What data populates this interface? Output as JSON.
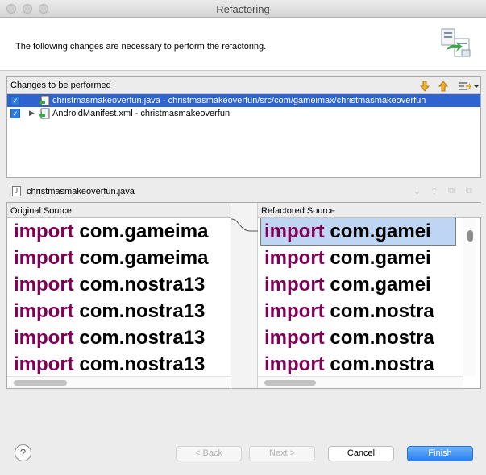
{
  "window": {
    "title": "Refactoring"
  },
  "banner": {
    "message": "The following changes are necessary to perform the refactoring."
  },
  "changes": {
    "header": "Changes to be performed",
    "items": [
      {
        "label": "christmasmakeoverfun.java - christmasmakeoverfun/src/com/gameimax/christmasmakeoverfun",
        "checked": true,
        "selected": true
      },
      {
        "label": "AndroidManifest.xml - christmasmakeoverfun",
        "checked": true,
        "selected": false
      }
    ]
  },
  "file": {
    "name": "christmasmakeoverfun.java"
  },
  "compare": {
    "original_header": "Original Source",
    "refactored_header": "Refactored Source",
    "original_lines": [
      {
        "kw": "import",
        "rest": "com.gameima"
      },
      {
        "kw": "import",
        "rest": "com.gameima"
      },
      {
        "kw": "import",
        "rest": "com.nostra13"
      },
      {
        "kw": "import",
        "rest": "com.nostra13"
      },
      {
        "kw": "import",
        "rest": "com.nostra13"
      },
      {
        "kw": "import",
        "rest": "com.nostra13"
      }
    ],
    "refactored_lines": [
      {
        "kw": "import",
        "rest": "com.gamei"
      },
      {
        "kw": "import",
        "rest": "com.gamei"
      },
      {
        "kw": "import",
        "rest": "com.gamei"
      },
      {
        "kw": "import",
        "rest": "com.nostra"
      },
      {
        "kw": "import",
        "rest": "com.nostra"
      },
      {
        "kw": "import",
        "rest": "com.nostra"
      }
    ]
  },
  "buttons": {
    "help": "?",
    "back": "< Back",
    "next": "Next >",
    "cancel": "Cancel",
    "finish": "Finish"
  },
  "colors": {
    "keyword": "#7f0055",
    "selection": "#2f64d0",
    "primary_button": "#2b7ef0"
  }
}
